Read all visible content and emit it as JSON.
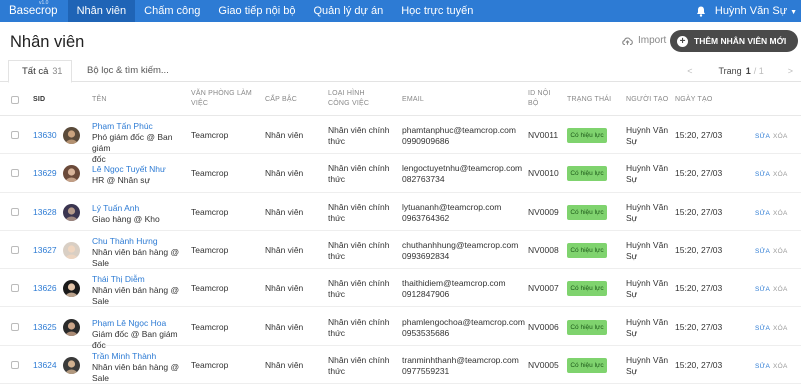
{
  "topbar": {
    "brand": "Basecrop",
    "version": "v1.0",
    "nav": [
      "Nhân viên",
      "Chấm công",
      "Giao tiếp nội bộ",
      "Quản lý dự án",
      "Học trực tuyến"
    ],
    "user": "Huỳnh Văn Sự"
  },
  "header": {
    "title": "Nhân viên",
    "import_label": "Import",
    "add_label": "THÊM NHÂN VIÊN MỚI"
  },
  "tabs": {
    "all_label": "Tất cả",
    "all_count": "31",
    "filter_label": "Bộ lọc & tìm kiếm...",
    "page_label": "Trang",
    "page_current": "1",
    "page_total": "/ 1"
  },
  "columns": {
    "sid": "SID",
    "name": "TÊN",
    "office": "VĂN PHÒNG LÀM VIỆC",
    "level": "CẤP BẬC",
    "type": "LOẠI HÌNH CÔNG VIỆC",
    "email": "EMAIL",
    "internal_id": "ID NỘI BỘ",
    "status": "TRẠNG THÁI",
    "creator": "NGƯỜI TẠO",
    "created": "NGÀY TẠO"
  },
  "action_labels": {
    "edit": "SỬA",
    "delete": "XÓA"
  },
  "rows": [
    {
      "sid": "13630",
      "name": "Phạm Tấn Phúc",
      "title_lines": [
        "Phó giám đốc @ Ban giám",
        "đốc"
      ],
      "office": "Teamcrop",
      "level": "Nhân viên",
      "type_lines": [
        "Nhân viên chính",
        "thức"
      ],
      "email": "phamtanphuc@teamcrop.com",
      "phone": "0990909686",
      "internal_id": "NV0011",
      "status": "Có hiệu lực",
      "creator_lines": [
        "Huỳnh Văn",
        "Sự"
      ],
      "created": "15:20, 27/03"
    },
    {
      "sid": "13629",
      "name": "Lê Ngọc Tuyết Như",
      "title_lines": [
        "HR @ Nhân sự"
      ],
      "office": "Teamcrop",
      "level": "Nhân viên",
      "type_lines": [
        "Nhân viên chính",
        "thức"
      ],
      "email": "lengoctuyetnhu@teamcrop.com",
      "phone": "082763734",
      "internal_id": "NV0010",
      "status": "Có hiệu lực",
      "creator_lines": [
        "Huỳnh Văn",
        "Sự"
      ],
      "created": "15:20, 27/03"
    },
    {
      "sid": "13628",
      "name": "Lý Tuấn Anh",
      "title_lines": [
        "Giao hàng @ Kho"
      ],
      "office": "Teamcrop",
      "level": "Nhân viên",
      "type_lines": [
        "Nhân viên chính",
        "thức"
      ],
      "email": "lytuananh@teamcrop.com",
      "phone": "0963764362",
      "internal_id": "NV0009",
      "status": "Có hiệu lực",
      "creator_lines": [
        "Huỳnh Văn",
        "Sự"
      ],
      "created": "15:20, 27/03"
    },
    {
      "sid": "13627",
      "name": "Chu Thành Hưng",
      "title_lines": [
        "Nhân viên bán hàng @",
        "Sale"
      ],
      "office": "Teamcrop",
      "level": "Nhân viên",
      "type_lines": [
        "Nhân viên chính",
        "thức"
      ],
      "email": "chuthanhhung@teamcrop.com",
      "phone": "0993692834",
      "internal_id": "NV0008",
      "status": "Có hiệu lực",
      "creator_lines": [
        "Huỳnh Văn",
        "Sự"
      ],
      "created": "15:20, 27/03"
    },
    {
      "sid": "13626",
      "name": "Thái Thị Diễm",
      "title_lines": [
        "Nhân viên bán hàng @",
        "Sale"
      ],
      "office": "Teamcrop",
      "level": "Nhân viên",
      "type_lines": [
        "Nhân viên chính",
        "thức"
      ],
      "email": "thaithidiem@teamcrop.com",
      "phone": "0912847906",
      "internal_id": "NV0007",
      "status": "Có hiệu lực",
      "creator_lines": [
        "Huỳnh Văn",
        "Sự"
      ],
      "created": "15:20, 27/03"
    },
    {
      "sid": "13625",
      "name": "Phạm Lê Ngọc Hoa",
      "title_lines": [
        "Giám đốc @ Ban giám đốc"
      ],
      "office": "Teamcrop",
      "level": "Nhân viên",
      "type_lines": [
        "Nhân viên chính",
        "thức"
      ],
      "email": "phamlengochoa@teamcrop.com",
      "phone": "0953535686",
      "internal_id": "NV0006",
      "status": "Có hiệu lực",
      "creator_lines": [
        "Huỳnh Văn",
        "Sự"
      ],
      "created": "15:20, 27/03"
    },
    {
      "sid": "13624",
      "name": "Trần Minh Thành",
      "title_lines": [
        "Nhân viên bán hàng @",
        "Sale"
      ],
      "office": "Teamcrop",
      "level": "Nhân viên",
      "type_lines": [
        "Nhân viên chính",
        "thức"
      ],
      "email": "tranminhthanh@teamcrop.com",
      "phone": "0977559231",
      "internal_id": "NV0005",
      "status": "Có hiệu lực",
      "creator_lines": [
        "Huỳnh Văn",
        "Sự"
      ],
      "created": "15:20, 27/03"
    }
  ],
  "colors": {
    "primary": "#2d7bd4",
    "nav_active": "#1f64b6",
    "badge": "#7fd36e",
    "add_button": "#4a4a4a"
  }
}
